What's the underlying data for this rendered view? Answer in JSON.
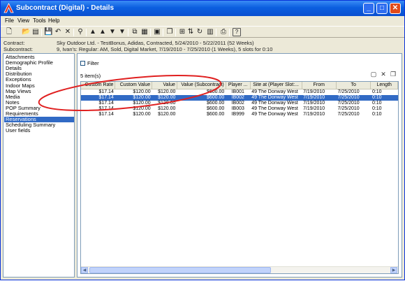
{
  "window": {
    "title": "Subcontract (Digital) - Details",
    "minimize": "_",
    "maximize": "□",
    "close": "✕"
  },
  "menu": [
    "File",
    "View",
    "Tools",
    "Help"
  ],
  "toolbar_icons": [
    "new-icon",
    "open-icon",
    "save-as-icon",
    "save-icon",
    "undo-icon",
    "delete-icon",
    "link-icon",
    "move-up-icon",
    "move-first-icon",
    "move-last-icon",
    "move-down-icon",
    "copy-icon",
    "book-icon",
    "report-icon",
    "window-icon",
    "tile-icon",
    "sort-icon",
    "refresh-icon",
    "calendar-icon",
    "print-icon",
    "info-icon",
    "help-icon"
  ],
  "info": {
    "contract_label": "Contract:",
    "contract_value": "Sky Outdoor Ltd. - TestBonus, Adidas, Contracted, 5/24/2010 - 5/22/2011 (52 Weeks)",
    "subcontract_label": "Subcontract:",
    "subcontract_value": "9, Ivan's: Regular: AM, Sold, Digital Market, 7/19/2010 - 7/25/2010 (1 Weeks), 5 slots for 0:10"
  },
  "sidebar": {
    "items": [
      "Attachments",
      "Demographic Profile",
      "Details",
      "Distribution",
      "Exceptions",
      "Indoor Maps",
      "Map Views",
      "Media",
      "Notes",
      "POP Summary",
      "Requirements",
      "Reservations",
      "Scheduling Summary",
      "User fields"
    ],
    "selected_index": 11
  },
  "filter": {
    "label": "Filter",
    "checked": false
  },
  "item_count": "5 item(s)",
  "grid": {
    "columns": [
      "Custom Rate",
      "Custom Value",
      "Value",
      "Value (Subcontract)",
      "Player ...",
      "Site at (Player Slot:...",
      "From",
      "To",
      "Length"
    ],
    "rows": [
      [
        "$17.14",
        "$120.00",
        "$120.00",
        "$600.00",
        "IB001",
        "49 The Donway West",
        "7/19/2010",
        "7/25/2010",
        "0:10"
      ],
      [
        "$17.14",
        "$120.00",
        "$120.00",
        "$600.00",
        "IB002",
        "49 The Donway West",
        "7/19/2010",
        "7/25/2010",
        "0:10"
      ],
      [
        "$17.14",
        "$120.00",
        "$120.00",
        "$600.00",
        "IB002",
        "49 The Donway West",
        "7/19/2010",
        "7/25/2010",
        "0:10"
      ],
      [
        "$17.14",
        "$120.00",
        "$120.00",
        "$600.00",
        "IB003",
        "49 The Donway West",
        "7/19/2010",
        "7/25/2010",
        "0:10"
      ],
      [
        "$17.14",
        "$120.00",
        "$120.00",
        "$600.00",
        "IB999",
        "49 The Donway West",
        "7/19/2010",
        "7/25/2010",
        "0:10"
      ]
    ],
    "selected_row": 1
  },
  "colors": {
    "title_bar": "#0b5fe0",
    "selection": "#316ac5",
    "annotation": "#e02020"
  }
}
